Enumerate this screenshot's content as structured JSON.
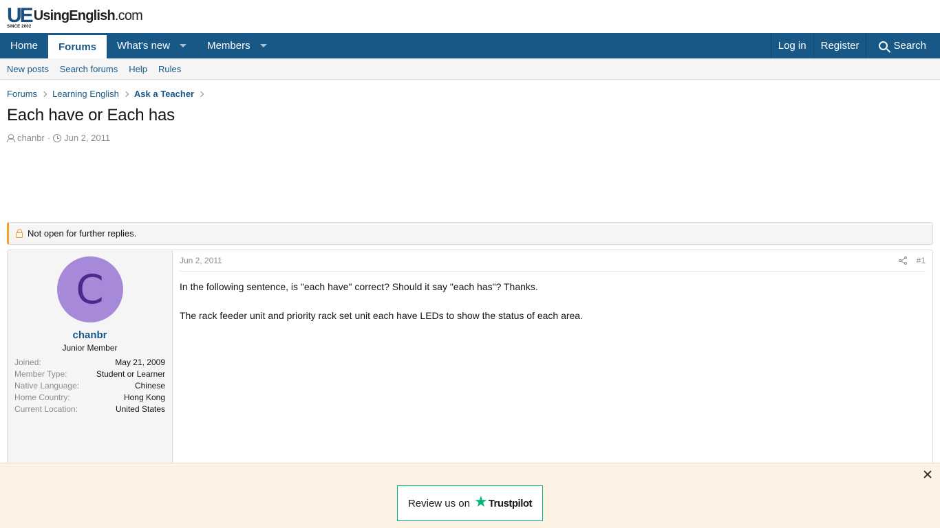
{
  "logo": {
    "mark": "UE",
    "since": "SINCE 2002",
    "name": "UsingEnglish",
    "tld": ".com"
  },
  "nav": {
    "tabs": [
      {
        "label": "Home"
      },
      {
        "label": "Forums"
      },
      {
        "label": "What's new"
      },
      {
        "label": "Members"
      }
    ],
    "right": [
      {
        "label": "Log in"
      },
      {
        "label": "Register"
      },
      {
        "label": "Search"
      }
    ]
  },
  "subnav": [
    "New posts",
    "Search forums",
    "Help",
    "Rules"
  ],
  "breadcrumb": [
    "Forums",
    "Learning English",
    "Ask a Teacher"
  ],
  "thread": {
    "title": "Each have or Each has",
    "author": "chanbr",
    "separator": "·",
    "date": "Jun 2, 2011"
  },
  "notice": "Not open for further replies.",
  "post": {
    "date": "Jun 2, 2011",
    "number": "#1",
    "avatar_letter": "C",
    "username": "chanbr",
    "user_title": "Junior Member",
    "extras": [
      {
        "label": "Joined:",
        "value": "May 21, 2009"
      },
      {
        "label": "Member Type:",
        "value": "Student or Learner"
      },
      {
        "label": "Native Language:",
        "value": "Chinese"
      },
      {
        "label": "Home Country:",
        "value": "Hong Kong"
      },
      {
        "label": "Current Location:",
        "value": "United States"
      }
    ],
    "body": [
      "In the following sentence, is \"each have\" correct? Should it say \"each has\"? Thanks.",
      "The rack feeder unit and priority rack set unit each have LEDs to show the status of each area."
    ]
  },
  "banner": {
    "label": "Review us on",
    "brand": "Trustpilot",
    "star": "★"
  },
  "colors": {
    "nav": "#185886",
    "accent": "#f3a125",
    "avatar": "#a789d9",
    "trustpilot": "#00b67a"
  }
}
